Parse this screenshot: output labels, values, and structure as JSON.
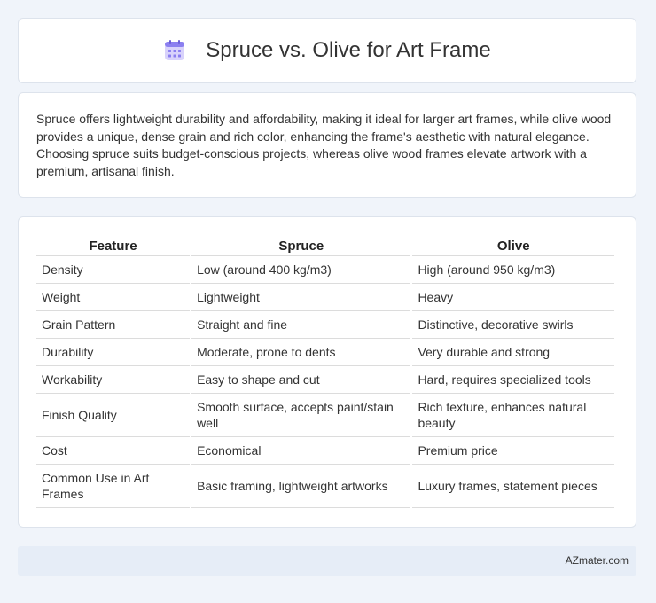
{
  "header": {
    "title": "Spruce vs. Olive for Art Frame",
    "icon": "calendar-icon",
    "icon_color": "#8b7ff0"
  },
  "summary": {
    "text": "Spruce offers lightweight durability and affordability, making it ideal for larger art frames, while olive wood provides a unique, dense grain and rich color, enhancing the frame's aesthetic with natural elegance. Choosing spruce suits budget-conscious projects, whereas olive wood frames elevate artwork with a premium, artisanal finish."
  },
  "table": {
    "headers": [
      "Feature",
      "Spruce",
      "Olive"
    ],
    "rows": [
      [
        "Density",
        "Low (around 400 kg/m3)",
        "High (around 950 kg/m3)"
      ],
      [
        "Weight",
        "Lightweight",
        "Heavy"
      ],
      [
        "Grain Pattern",
        "Straight and fine",
        "Distinctive, decorative swirls"
      ],
      [
        "Durability",
        "Moderate, prone to dents",
        "Very durable and strong"
      ],
      [
        "Workability",
        "Easy to shape and cut",
        "Hard, requires specialized tools"
      ],
      [
        "Finish Quality",
        "Smooth surface, accepts paint/stain well",
        "Rich texture, enhances natural beauty"
      ],
      [
        "Cost",
        "Economical",
        "Premium price"
      ],
      [
        "Common Use in Art Frames",
        "Basic framing, lightweight artworks",
        "Luxury frames, statement pieces"
      ]
    ]
  },
  "footer": {
    "text": "AZmater.com"
  }
}
